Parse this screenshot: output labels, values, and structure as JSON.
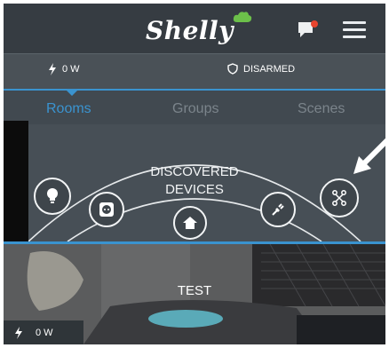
{
  "header": {
    "logo_text": "Shelly"
  },
  "status": {
    "power": "0 W",
    "alarm": "DISARMED"
  },
  "tabs": [
    {
      "label": "Rooms",
      "active": true
    },
    {
      "label": "Groups",
      "active": false
    },
    {
      "label": "Scenes",
      "active": false
    }
  ],
  "discover": {
    "title_line1": "DISCOVERED",
    "title_line2": "DEVICES",
    "icons": [
      "lightbulb-icon",
      "socket-icon",
      "home-icon",
      "plug-icon",
      "network-icon"
    ]
  },
  "room": {
    "name": "TEST",
    "power": "0 W"
  },
  "colors": {
    "accent": "#3a93cf",
    "notification": "#e8442e",
    "cloud": "#6cc04a"
  }
}
